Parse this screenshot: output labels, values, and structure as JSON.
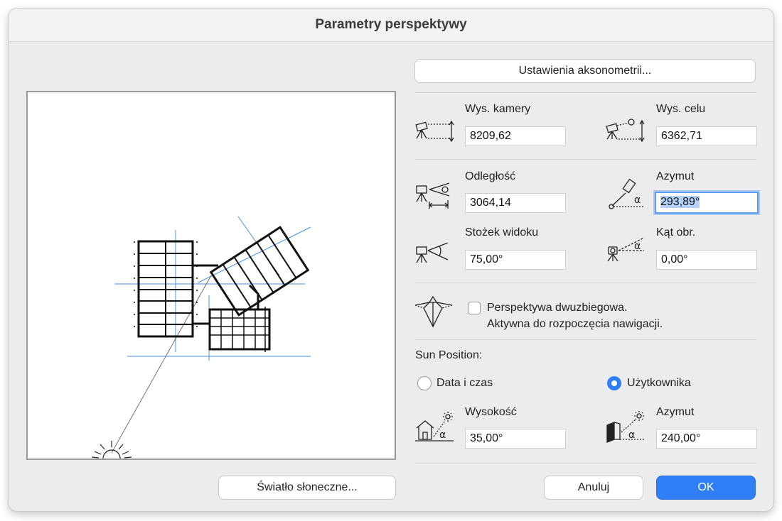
{
  "window": {
    "title": "Parametry perspektywy"
  },
  "buttons": {
    "axonometry": "Ustawienia aksonometrii...",
    "sunlight": "Światło słoneczne...",
    "cancel": "Anuluj",
    "ok": "OK"
  },
  "camera": {
    "camera_height": {
      "label": "Wys. kamery",
      "value": "8209,62"
    },
    "target_height": {
      "label": "Wys. celu",
      "value": "6362,71"
    },
    "distance": {
      "label": "Odległość",
      "value": "3064,14"
    },
    "azimuth": {
      "label": "Azymut",
      "value": "293,89°"
    },
    "view_cone": {
      "label": "Stożek widoku",
      "value": "75,00°"
    },
    "roll_angle": {
      "label": "Kąt obr.",
      "value": "0,00°"
    }
  },
  "two_point": {
    "checked": false,
    "line1": "Perspektywa dwuzbiegowa.",
    "line2": "Aktywna do rozpoczęcia nawigacji."
  },
  "sun": {
    "section_label": "Sun Position:",
    "option_datetime": "Data i czas",
    "option_user": "Użytkownika",
    "selected": "user",
    "altitude": {
      "label": "Wysokość",
      "value": "35,00°"
    },
    "azimuth": {
      "label": "Azymut",
      "value": "240,00°"
    }
  },
  "colors": {
    "accent": "#2f7ef6",
    "guide_line": "#4a90e2",
    "plan_line": "#111111"
  },
  "icons": [
    "camera-height-icon",
    "target-height-icon",
    "distance-icon",
    "azimuth-icon",
    "view-cone-icon",
    "roll-angle-icon",
    "two-point-perspective-icon",
    "sun-altitude-icon",
    "sun-azimuth-icon",
    "sun-icon"
  ]
}
